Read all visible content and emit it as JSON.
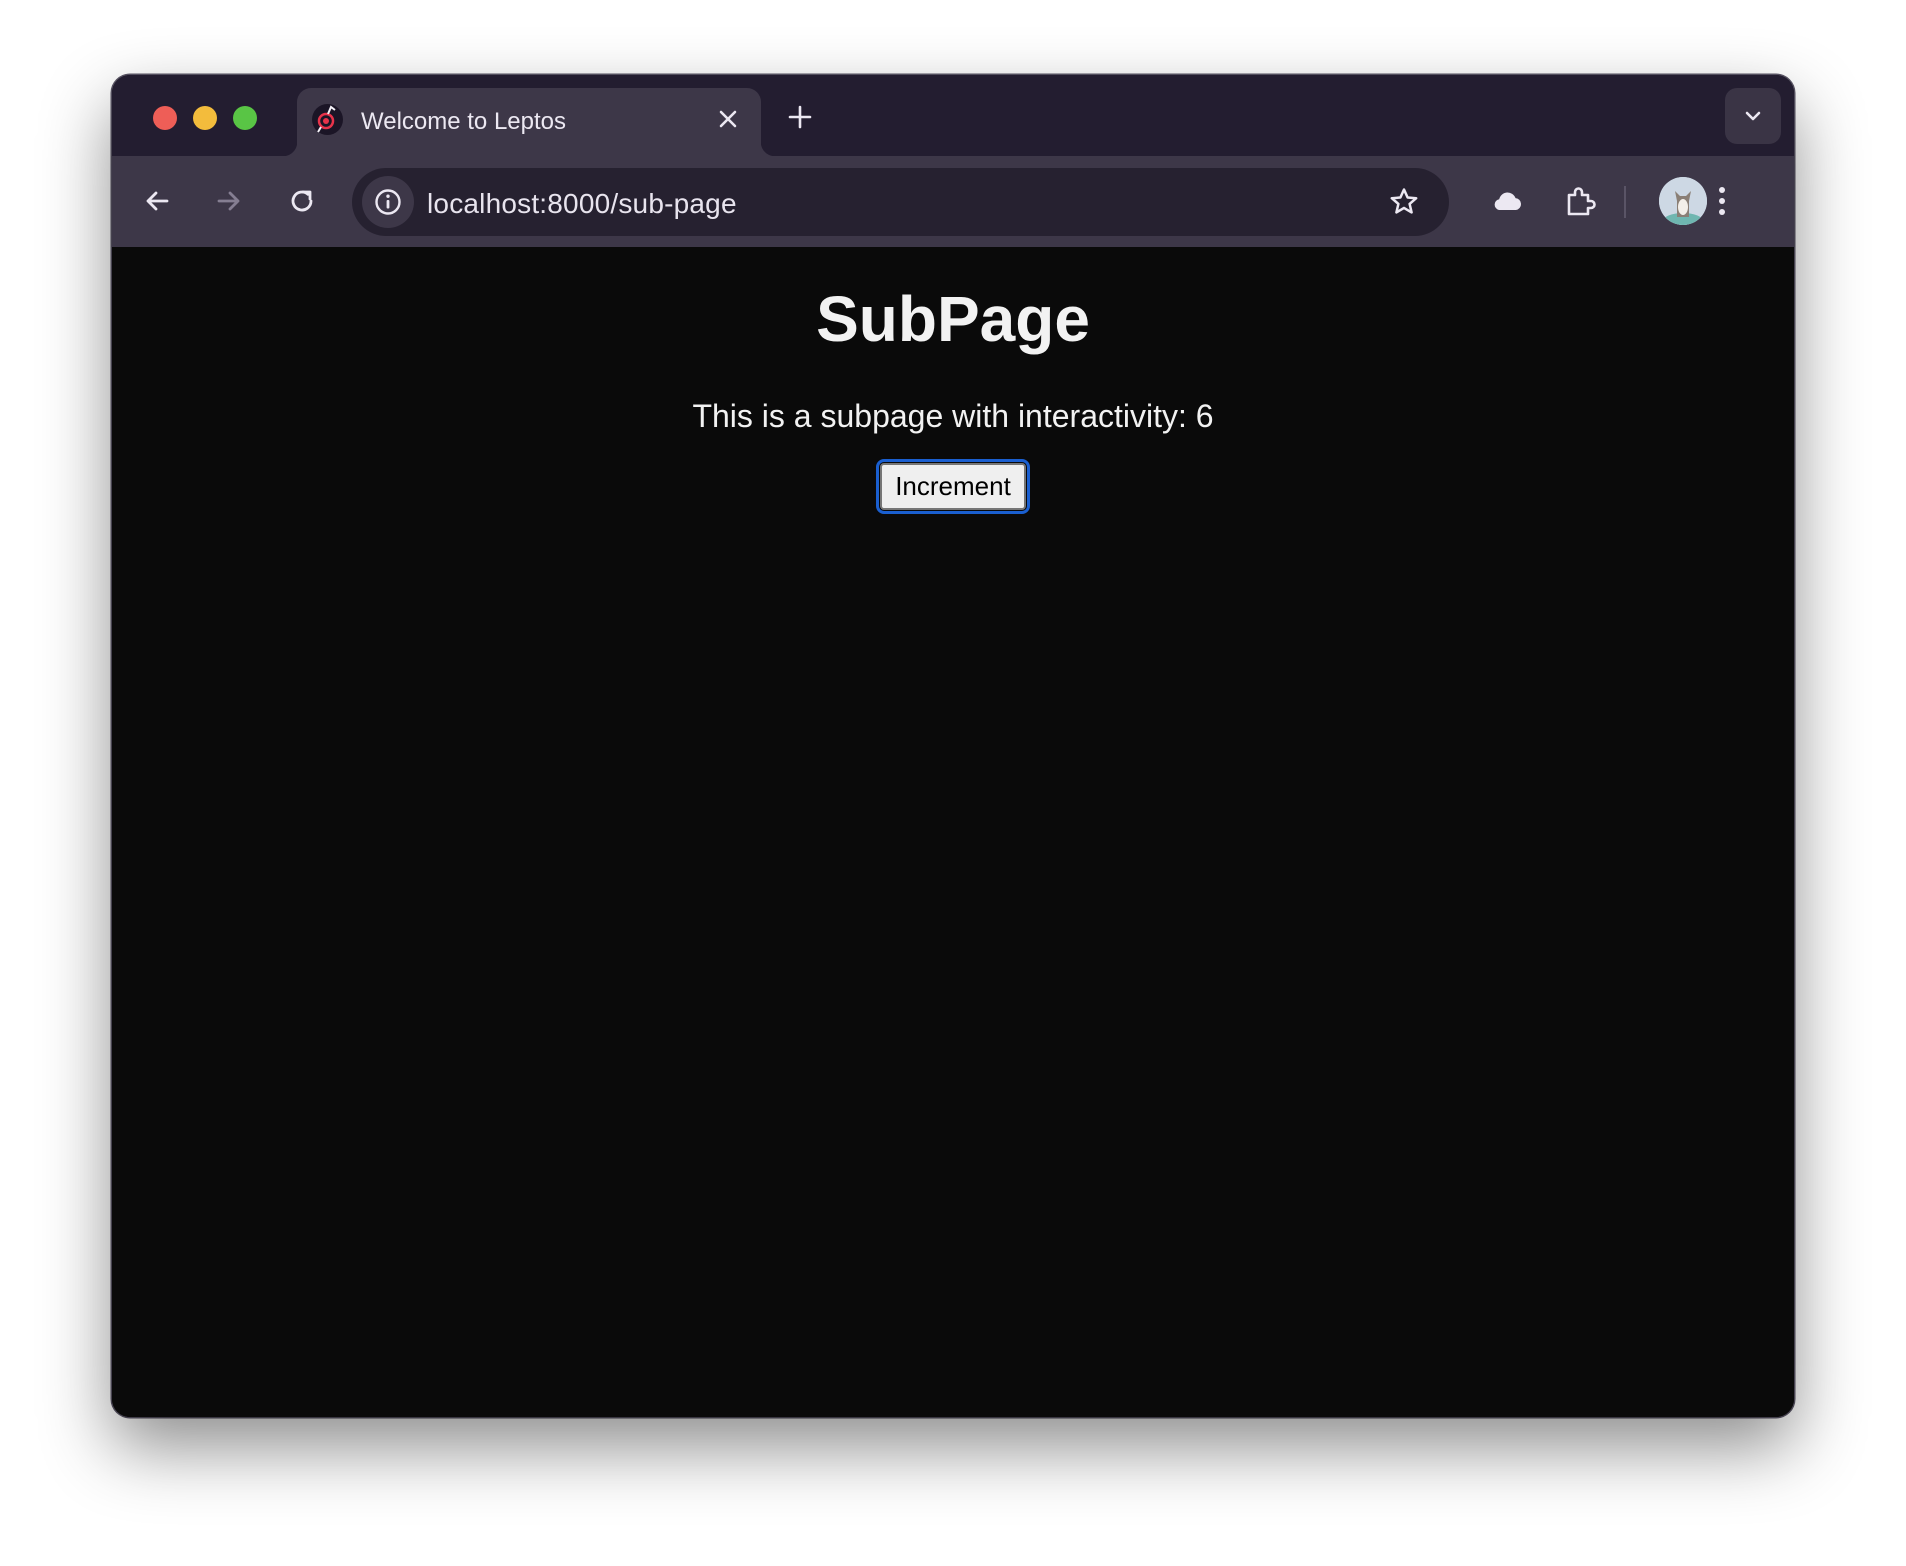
{
  "tab": {
    "title": "Welcome to Leptos"
  },
  "address_bar": {
    "url": "localhost:8000/sub-page"
  },
  "page": {
    "heading": "SubPage",
    "text_prefix": "This is a subpage with interactivity: ",
    "counter": 6,
    "button_label": "Increment"
  },
  "colors": {
    "tabstrip": "#231d30",
    "toolbar": "#3d3748",
    "page_background": "#0a0a0a",
    "button_focus": "#1a5fd0"
  },
  "icons": {
    "back": "arrow-left-icon",
    "forward": "arrow-right-icon",
    "reload": "reload-icon",
    "site_info": "info-icon",
    "bookmark": "star-icon",
    "sync": "cloud-icon",
    "extensions": "puzzle-icon",
    "menu": "kebab-menu-icon"
  }
}
